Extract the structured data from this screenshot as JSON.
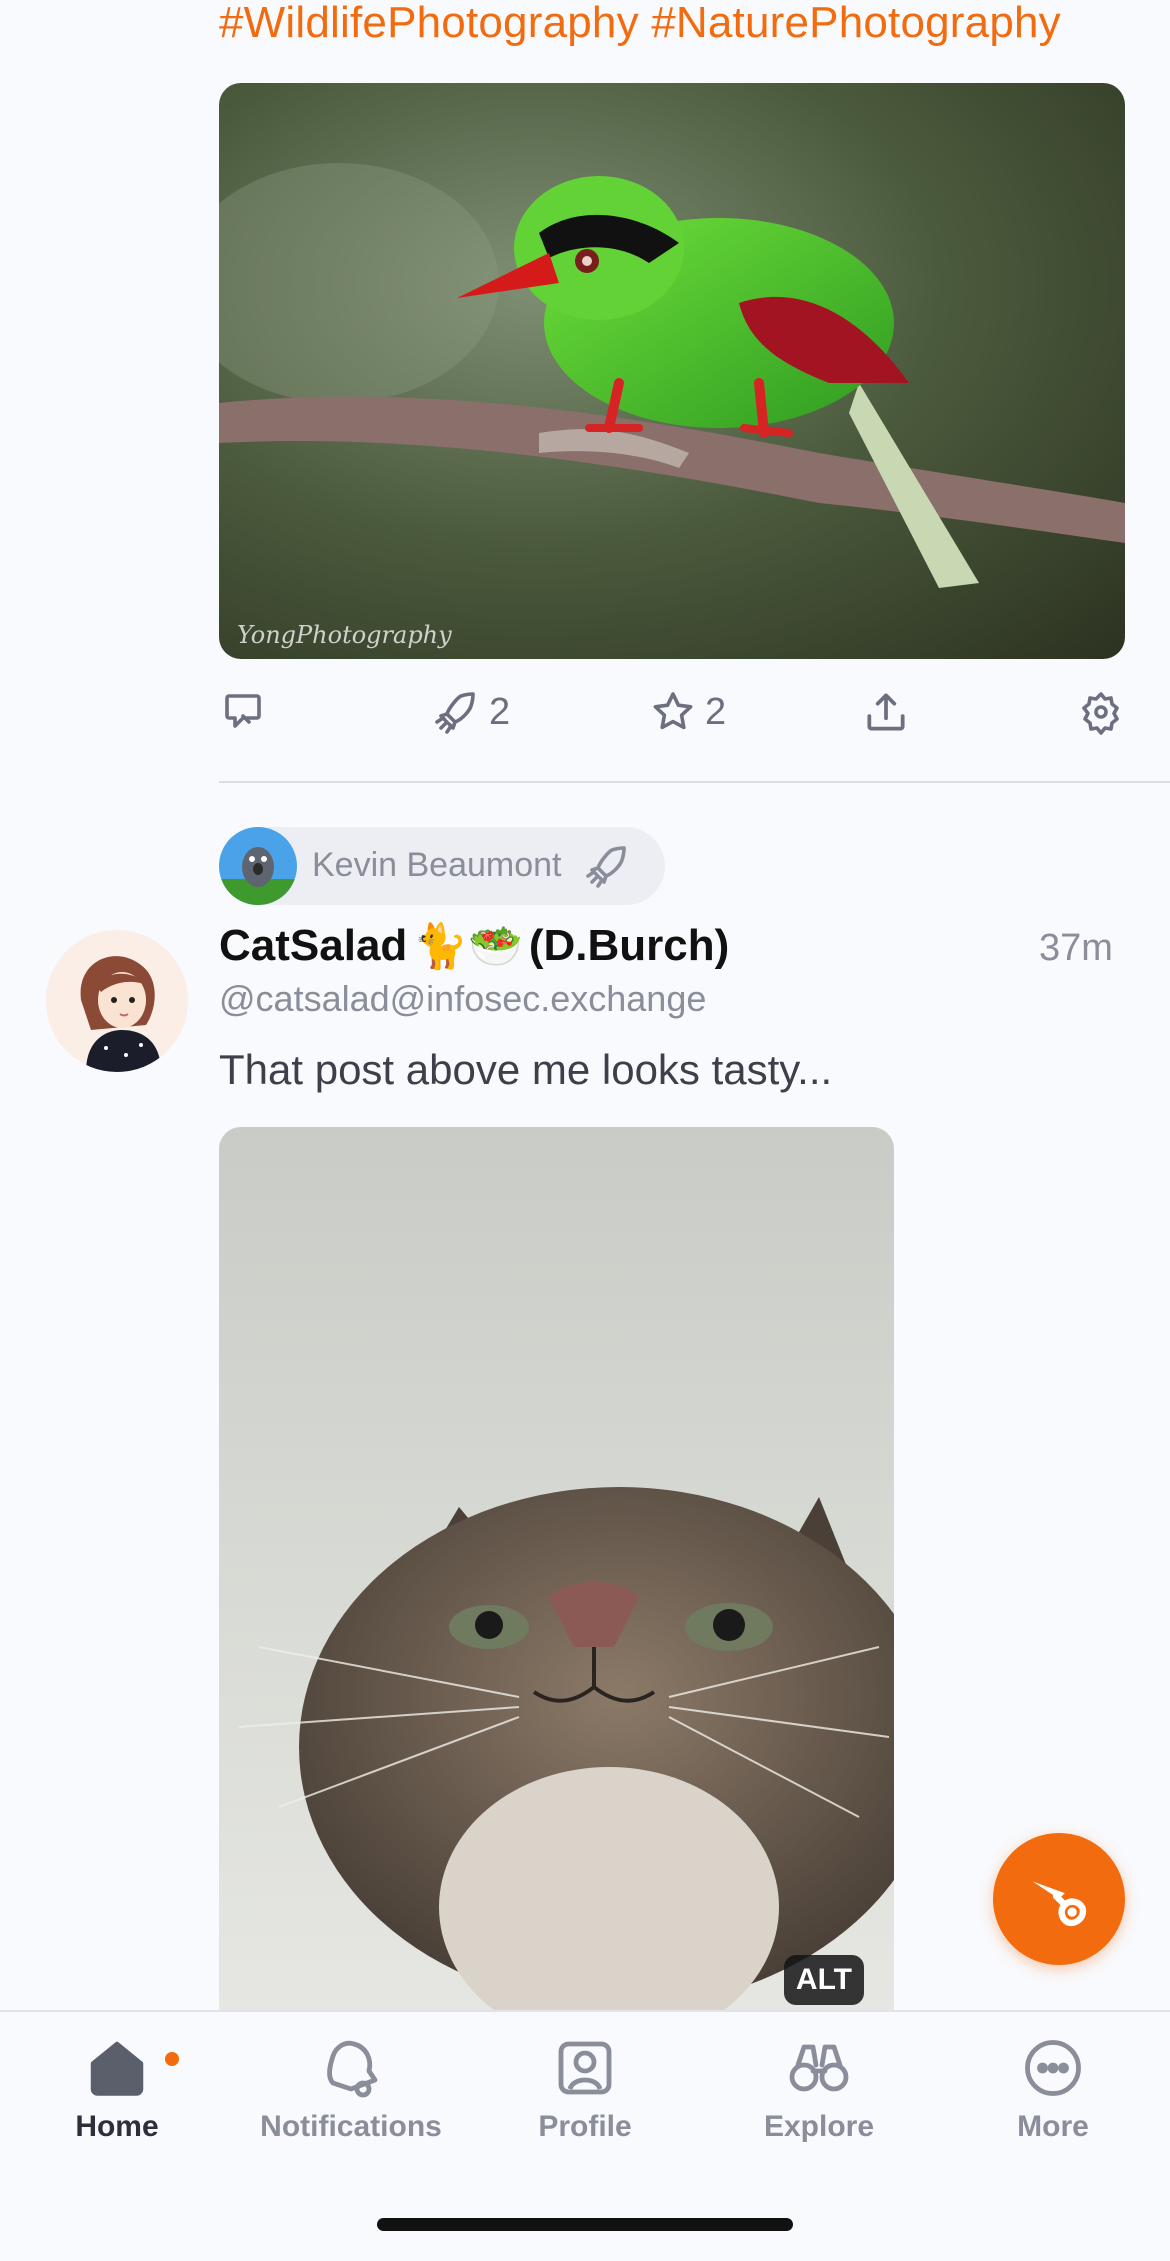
{
  "feed": {
    "prev_post": {
      "hashtags": "#WildlifePhotography #NaturePhotography",
      "image_watermark": "YongPhotography",
      "boost_count": "2",
      "favourite_count": "2"
    },
    "post": {
      "boosted_by": "Kevin Beaumont",
      "display_name": "CatSalad",
      "display_name_emoji": "🐈🥗",
      "display_name_suffix": "(D.Burch)",
      "handle": "@catsalad@infosec.exchange",
      "time_ago": "37m",
      "text": "That post above me looks tasty...",
      "alt_badge": "ALT"
    }
  },
  "tabbar": {
    "home": "Home",
    "notifications": "Notifications",
    "profile": "Profile",
    "explore": "Explore",
    "more": "More"
  },
  "colors": {
    "accent": "#f26b0f",
    "muted": "#8a8d9a",
    "background": "#f9fafd"
  },
  "icons": [
    "reply-icon",
    "boost-icon",
    "favourite-icon",
    "share-icon",
    "more-actions-icon",
    "compose-horn-icon",
    "home-icon",
    "notifications-bell-icon",
    "profile-icon",
    "explore-binoculars-icon",
    "more-icon"
  ]
}
